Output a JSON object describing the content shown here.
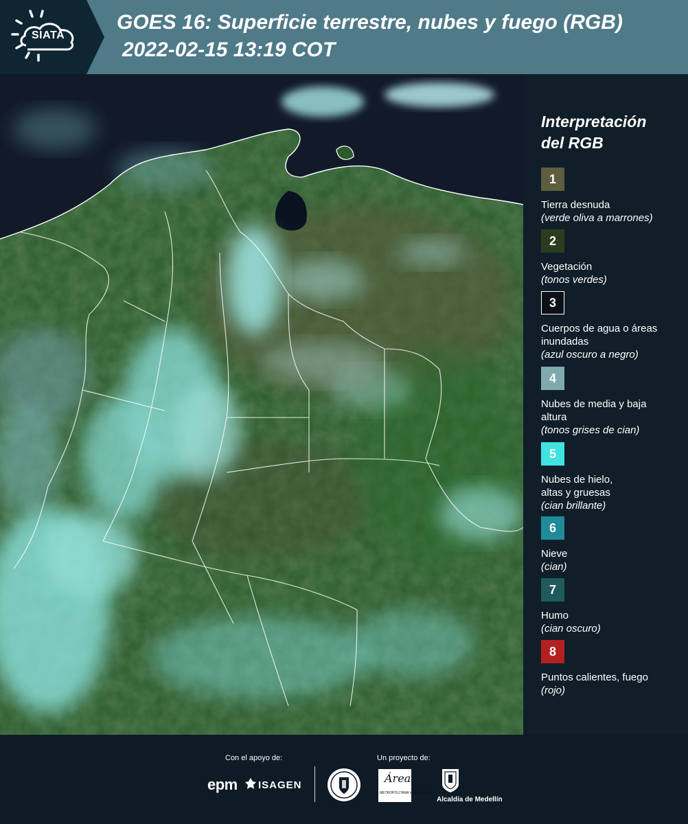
{
  "header": {
    "logo_text": "SIATA",
    "title": "GOES 16: Superficie terrestre, nubes y fuego (RGB)",
    "datetime": "2022-02-15 13:19 COT"
  },
  "legend": {
    "title_line1": "Interpretación",
    "title_line2": "del RGB",
    "items": [
      {
        "number": "1",
        "color": "#5e5d3f",
        "label": "Tierra desnuda",
        "desc": "(verde oliva a marrones)"
      },
      {
        "number": "2",
        "color": "#2b3d1e",
        "label": "Vegetación",
        "desc": "(tonos verdes)"
      },
      {
        "number": "3",
        "color": "#0a1016",
        "label": "Cuerpos de agua o áreas inundadas",
        "desc": "(azul oscuro a negro)"
      },
      {
        "number": "4",
        "color": "#7fa9ad",
        "label": "Nubes de media y baja altura",
        "desc": "(tonos grises de cian)"
      },
      {
        "number": "5",
        "color": "#3fe3e0",
        "label": "Nubes de hielo, altas y gruesas",
        "desc": "(cian brillante)"
      },
      {
        "number": "6",
        "color": "#1f8a9a",
        "label": "Nieve",
        "desc": "(cian)"
      },
      {
        "number": "7",
        "color": "#1f5a5c",
        "label": "Humo",
        "desc": "(cian oscuro)"
      },
      {
        "number": "8",
        "color": "#b3201f",
        "label": "Puntos calientes, fuego",
        "desc": "(rojo)"
      }
    ]
  },
  "footer": {
    "support_label": "Con el apoyo de:",
    "project_label": "Un proyecto de:",
    "epm": "epm",
    "isagen": "ISAGEN",
    "area_word": "Área",
    "area_sub": "METROPOLITANA Valle de Aburrá",
    "medellin": "Alcaldía de Medellín"
  },
  "colors": {
    "header_bg": "#4f7a88",
    "logo_bg": "#0e2532",
    "page_bg": "#0d1b26",
    "ocean": "#121a2a",
    "vegetation": "#2c5a2a",
    "cloud": "#8fe8e6",
    "border": "#ffffff"
  }
}
